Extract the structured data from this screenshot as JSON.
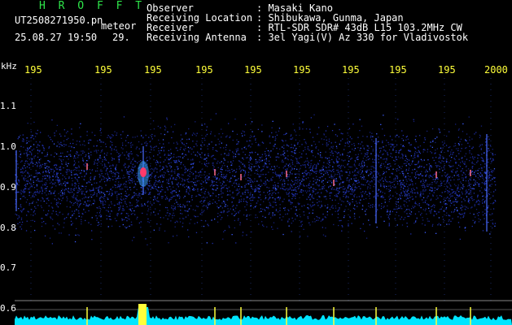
{
  "app": {
    "title": "H R O F F T"
  },
  "file": {
    "name": "UT2508271950.pn",
    "tag": "meteor",
    "datetime": "25.08.27 19:50",
    "count": "29."
  },
  "info": [
    {
      "label": "Observer",
      "value": ": Masaki Kano"
    },
    {
      "label": "Receiving Location",
      "value": ": Shibukawa, Gunma, Japan"
    },
    {
      "label": "Receiver",
      "value": ": RTL-SDR SDR# 43dB L15 103.2MHz CW"
    },
    {
      "label": "Receiving Antenna",
      "value": ": 3el Yagi(V) Az 330 for Vladivostok"
    }
  ],
  "axes": {
    "y_unit": "kHz",
    "y_ticks": [
      "1.1",
      "1.0",
      "0.9",
      "0.8",
      "0.7",
      "0.6"
    ],
    "x_ticks": [
      "195",
      "195",
      "195",
      "195",
      "195",
      "195",
      "195",
      "195",
      "195",
      "2000"
    ]
  },
  "colors": {
    "background": "#000000",
    "title": "#2ee64a",
    "x_labels": "#ffff3a",
    "signal": "#00e5ff"
  }
}
